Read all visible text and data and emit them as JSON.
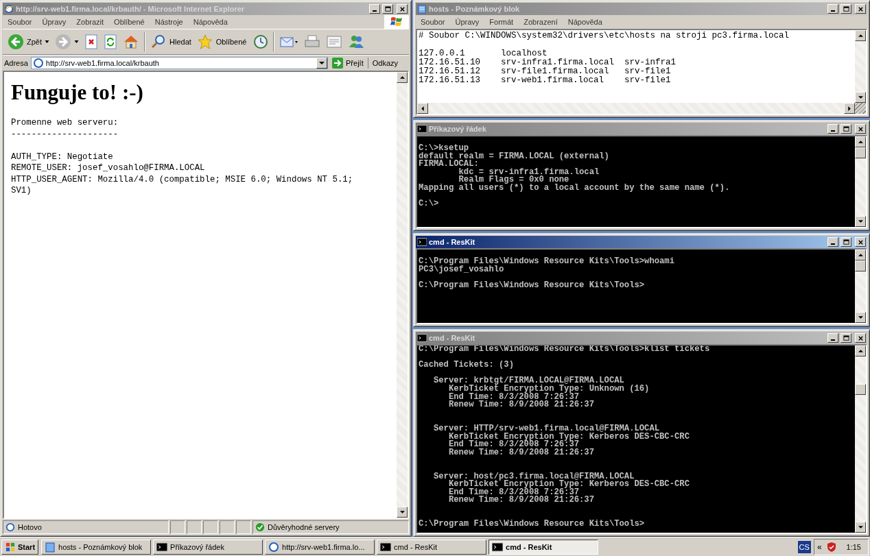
{
  "windows": [
    {
      "kind": "browser",
      "title": "http://srv-web1.firma.local/krbauth/ - Microsoft Internet Explorer",
      "active": false,
      "menu": [
        "Soubor",
        "Úpravy",
        "Zobrazit",
        "Oblíbené",
        "Nástroje",
        "Nápověda"
      ],
      "toolbar": [
        {
          "kind": "back",
          "label": "Zpět"
        },
        {
          "kind": "forward"
        },
        {
          "kind": "stop"
        },
        {
          "kind": "refresh"
        },
        {
          "kind": "home"
        },
        {
          "kind": "separator"
        },
        {
          "kind": "search",
          "label": "Hledat"
        },
        {
          "kind": "favorites",
          "label": "Oblíbené"
        },
        {
          "kind": "history"
        },
        {
          "kind": "separator"
        },
        {
          "kind": "mail"
        },
        {
          "kind": "print"
        },
        {
          "kind": "edit"
        },
        {
          "kind": "messenger"
        }
      ],
      "address": {
        "label": "Adresa",
        "value": "http://srv-web1.firma.local/krbauth",
        "go": "Přejít",
        "links": "Odkazy"
      },
      "page": {
        "heading": "Funguje to! :-)",
        "body": "Promenne web serveru:\n---------------------\n\nAUTH_TYPE: Negotiate\nREMOTE_USER: josef_vosahlo@FIRMA.LOCAL\nHTTP_USER_AGENT: Mozilla/4.0 (compatible; MSIE 6.0; Windows NT 5.1; SV1)"
      },
      "status": {
        "text": "Hotovo",
        "zone": "Důvěryhodné servery"
      }
    },
    {
      "kind": "notepad",
      "title": "hosts - Poznámkový blok",
      "active": false,
      "menu": [
        "Soubor",
        "Úpravy",
        "Formát",
        "Zobrazení",
        "Nápověda"
      ],
      "text": "# Soubor C:\\WINDOWS\\system32\\drivers\\etc\\hosts na stroji pc3.firma.local\n\n127.0.0.1       localhost\n172.16.51.10    srv-infra1.firma.local  srv-infra1\n172.16.51.12    srv-file1.firma.local   srv-file1\n172.16.51.13    srv-web1.firma.local    srv-file1"
    },
    {
      "kind": "console",
      "title": "Příkazový řádek",
      "active": false,
      "text": "C:\\>ksetup\ndefault realm = FIRMA.LOCAL (external)\nFIRMA.LOCAL:\n        kdc = srv-infra1.firma.local\n        Realm Flags = 0x0 none\nMapping all users (*) to a local account by the same name (*).\n\nC:\\>"
    },
    {
      "kind": "console",
      "title": "cmd - ResKit",
      "active": true,
      "text": "C:\\Program Files\\Windows Resource Kits\\Tools>whoami\nPC3\\josef_vosahlo\n\nC:\\Program Files\\Windows Resource Kits\\Tools>"
    },
    {
      "kind": "console",
      "title": "cmd - ResKit",
      "active": false,
      "text": "C:\\Program Files\\Windows Resource Kits\\Tools>klist tickets\n\nCached Tickets: (3)\n\n   Server: krbtgt/FIRMA.LOCAL@FIRMA.LOCAL\n      KerbTicket Encryption Type: Unknown (16)\n      End Time: 8/3/2008 7:26:37\n      Renew Time: 8/9/2008 21:26:37\n\n\n   Server: HTTP/srv-web1.firma.local@FIRMA.LOCAL\n      KerbTicket Encryption Type: Kerberos DES-CBC-CRC\n      End Time: 8/3/2008 7:26:37\n      Renew Time: 8/9/2008 21:26:37\n\n\n   Server: host/pc3.firma.local@FIRMA.LOCAL\n      KerbTicket Encryption Type: Kerberos DES-CBC-CRC\n      End Time: 8/3/2008 7:26:37\n      Renew Time: 8/9/2008 21:26:37\n\n\nC:\\Program Files\\Windows Resource Kits\\Tools>"
    }
  ],
  "taskbar": {
    "start": "Start",
    "buttons": [
      {
        "kind": "notepad",
        "label": "hosts - Poznámkový blok",
        "selected": false
      },
      {
        "kind": "console",
        "label": "Příkazový řádek",
        "selected": false
      },
      {
        "kind": "browser",
        "label": "http://srv-web1.firma.lo...",
        "selected": false
      },
      {
        "kind": "console",
        "label": "cmd - ResKit",
        "selected": false
      },
      {
        "kind": "console",
        "label": "cmd - ResKit",
        "selected": true
      }
    ],
    "language": "CS",
    "expand": "«",
    "clock": "1:15"
  }
}
